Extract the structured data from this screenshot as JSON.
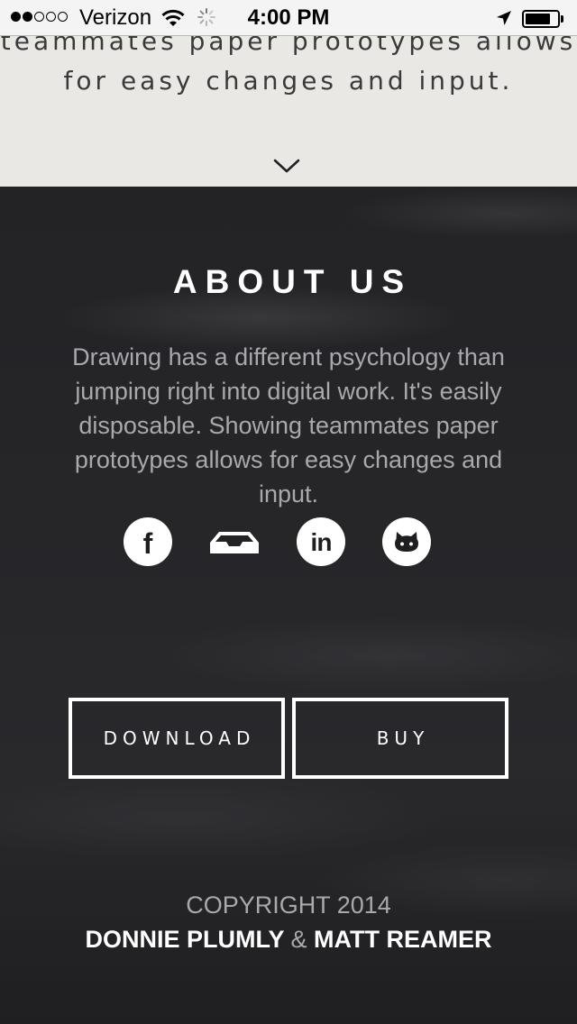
{
  "status_bar": {
    "carrier": "Verizon",
    "time": "4:00 PM",
    "signal_bars_filled": 2,
    "signal_bars_total": 5,
    "battery_level": 0.8,
    "icons": [
      "wifi-icon",
      "loading-spinner-icon",
      "location-arrow-icon",
      "battery-icon"
    ]
  },
  "hero": {
    "text_lines": [
      "teammates paper prototypes allows",
      "for easy changes and input."
    ],
    "scroll_icon": "chevron-down-icon"
  },
  "about": {
    "title": "ABOUT US",
    "body_lines": [
      "Drawing has a different psychology than",
      "jumping right into digital work. It's easily",
      "disposable. Showing teammates paper",
      "prototypes allows for easy changes and",
      "input."
    ],
    "social_icons": [
      "facebook-icon",
      "inbox-icon",
      "linkedin-icon",
      "github-icon"
    ],
    "facebook_glyph": "f",
    "linkedin_glyph": "in"
  },
  "buttons": {
    "download_label": "DOWNLOAD",
    "buy_label": "BUY"
  },
  "footer": {
    "copyright": "COPYRIGHT 2014",
    "author_1": "DONNIE PLUMLY",
    "ampersand": "&",
    "author_2": "MATT REAMER"
  },
  "colors": {
    "status_bar_bg": "#f4f4f4",
    "hero_bg": "#eae8e5",
    "hero_text": "#3a3a3a",
    "section_bg": "#232325",
    "muted_text": "#a9a9ad",
    "white": "#ffffff"
  }
}
